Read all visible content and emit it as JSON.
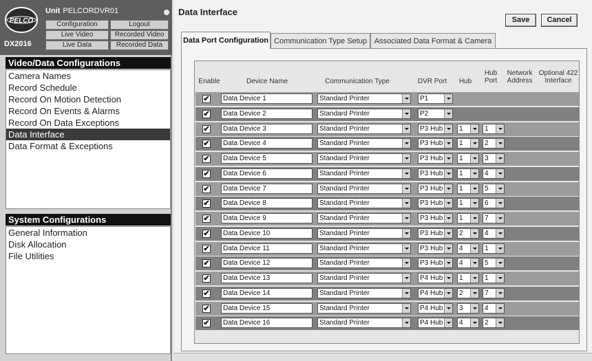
{
  "unit": {
    "label": "Unit",
    "name": "PELCORDVR01"
  },
  "brand": {
    "logo_text": "PELCO",
    "model": "DX2016"
  },
  "nav": {
    "configuration": "Configuration",
    "logout": "Logout",
    "live_video": "Live Video",
    "recorded_video": "Recorded Video",
    "live_data": "Live Data",
    "recorded_data": "Recorded Data"
  },
  "sidebar": {
    "video_title": "Video/Data Configurations",
    "video_items": [
      "Camera Names",
      "Record Schedule",
      "Record On Motion Detection",
      "Record On Events & Alarms",
      "Record On Data Exceptions",
      "Data Interface",
      "Data Format & Exceptions"
    ],
    "active_index": 5,
    "system_title": "System Configurations",
    "system_items": [
      "General Information",
      "Disk Allocation",
      "File Utilities"
    ]
  },
  "main": {
    "title": "Data Interface",
    "save": "Save",
    "cancel": "Cancel",
    "tabs": [
      "Data Port Configuration",
      "Communication Type Setup",
      "Associated Data Format & Camera"
    ],
    "active_tab": 0
  },
  "table": {
    "headers": {
      "enable": "Enable",
      "device_name": "Device Name",
      "comm_type": "Communication Type",
      "dvr_port": "DVR Port",
      "hub": "Hub",
      "hub_port_1": "Hub",
      "hub_port_2": "Port",
      "network_1": "Network",
      "network_2": "Address",
      "optional_1": "Optional 422",
      "optional_2": "Interface"
    },
    "check_mark": "✔",
    "rows": [
      {
        "enabled": true,
        "name": "Data Device 1",
        "comm": "Standard Printer",
        "port": "P1",
        "hub": "",
        "hubport": ""
      },
      {
        "enabled": true,
        "name": "Data Device 2",
        "comm": "Standard Printer",
        "port": "P2",
        "hub": "",
        "hubport": ""
      },
      {
        "enabled": true,
        "name": "Data Device 3",
        "comm": "Standard Printer",
        "port": "P3 Hub",
        "hub": "1",
        "hubport": "1"
      },
      {
        "enabled": true,
        "name": "Data Device 4",
        "comm": "Standard Printer",
        "port": "P3 Hub",
        "hub": "1",
        "hubport": "2"
      },
      {
        "enabled": true,
        "name": "Data Device 5",
        "comm": "Standard Printer",
        "port": "P3 Hub",
        "hub": "1",
        "hubport": "3"
      },
      {
        "enabled": true,
        "name": "Data Device 6",
        "comm": "Standard Printer",
        "port": "P3 Hub",
        "hub": "1",
        "hubport": "4"
      },
      {
        "enabled": true,
        "name": "Data Device 7",
        "comm": "Standard Printer",
        "port": "P3 Hub",
        "hub": "1",
        "hubport": "5"
      },
      {
        "enabled": true,
        "name": "Data Device 8",
        "comm": "Standard Printer",
        "port": "P3 Hub",
        "hub": "1",
        "hubport": "6"
      },
      {
        "enabled": true,
        "name": "Data Device 9",
        "comm": "Standard Printer",
        "port": "P3 Hub",
        "hub": "1",
        "hubport": "7"
      },
      {
        "enabled": true,
        "name": "Data Device 10",
        "comm": "Standard Printer",
        "port": "P3 Hub",
        "hub": "2",
        "hubport": "4"
      },
      {
        "enabled": true,
        "name": "Data Device 11",
        "comm": "Standard Printer",
        "port": "P3 Hub",
        "hub": "4",
        "hubport": "1"
      },
      {
        "enabled": true,
        "name": "Data Device 12",
        "comm": "Standard Printer",
        "port": "P3 Hub",
        "hub": "4",
        "hubport": "5"
      },
      {
        "enabled": true,
        "name": "Data Device 13",
        "comm": "Standard Printer",
        "port": "P4 Hub",
        "hub": "1",
        "hubport": "1"
      },
      {
        "enabled": true,
        "name": "Data Device 14",
        "comm": "Standard Printer",
        "port": "P4 Hub",
        "hub": "2",
        "hubport": "7"
      },
      {
        "enabled": true,
        "name": "Data Device 15",
        "comm": "Standard Printer",
        "port": "P4 Hub",
        "hub": "3",
        "hubport": "4"
      },
      {
        "enabled": true,
        "name": "Data Device 16",
        "comm": "Standard Printer",
        "port": "P4 Hub",
        "hub": "4",
        "hubport": "2"
      }
    ]
  },
  "colors": {
    "row_light": "#9c9c9c",
    "row_dark": "#808080",
    "header_bg": "#111111",
    "brand_bg": "#5e5e5e"
  }
}
